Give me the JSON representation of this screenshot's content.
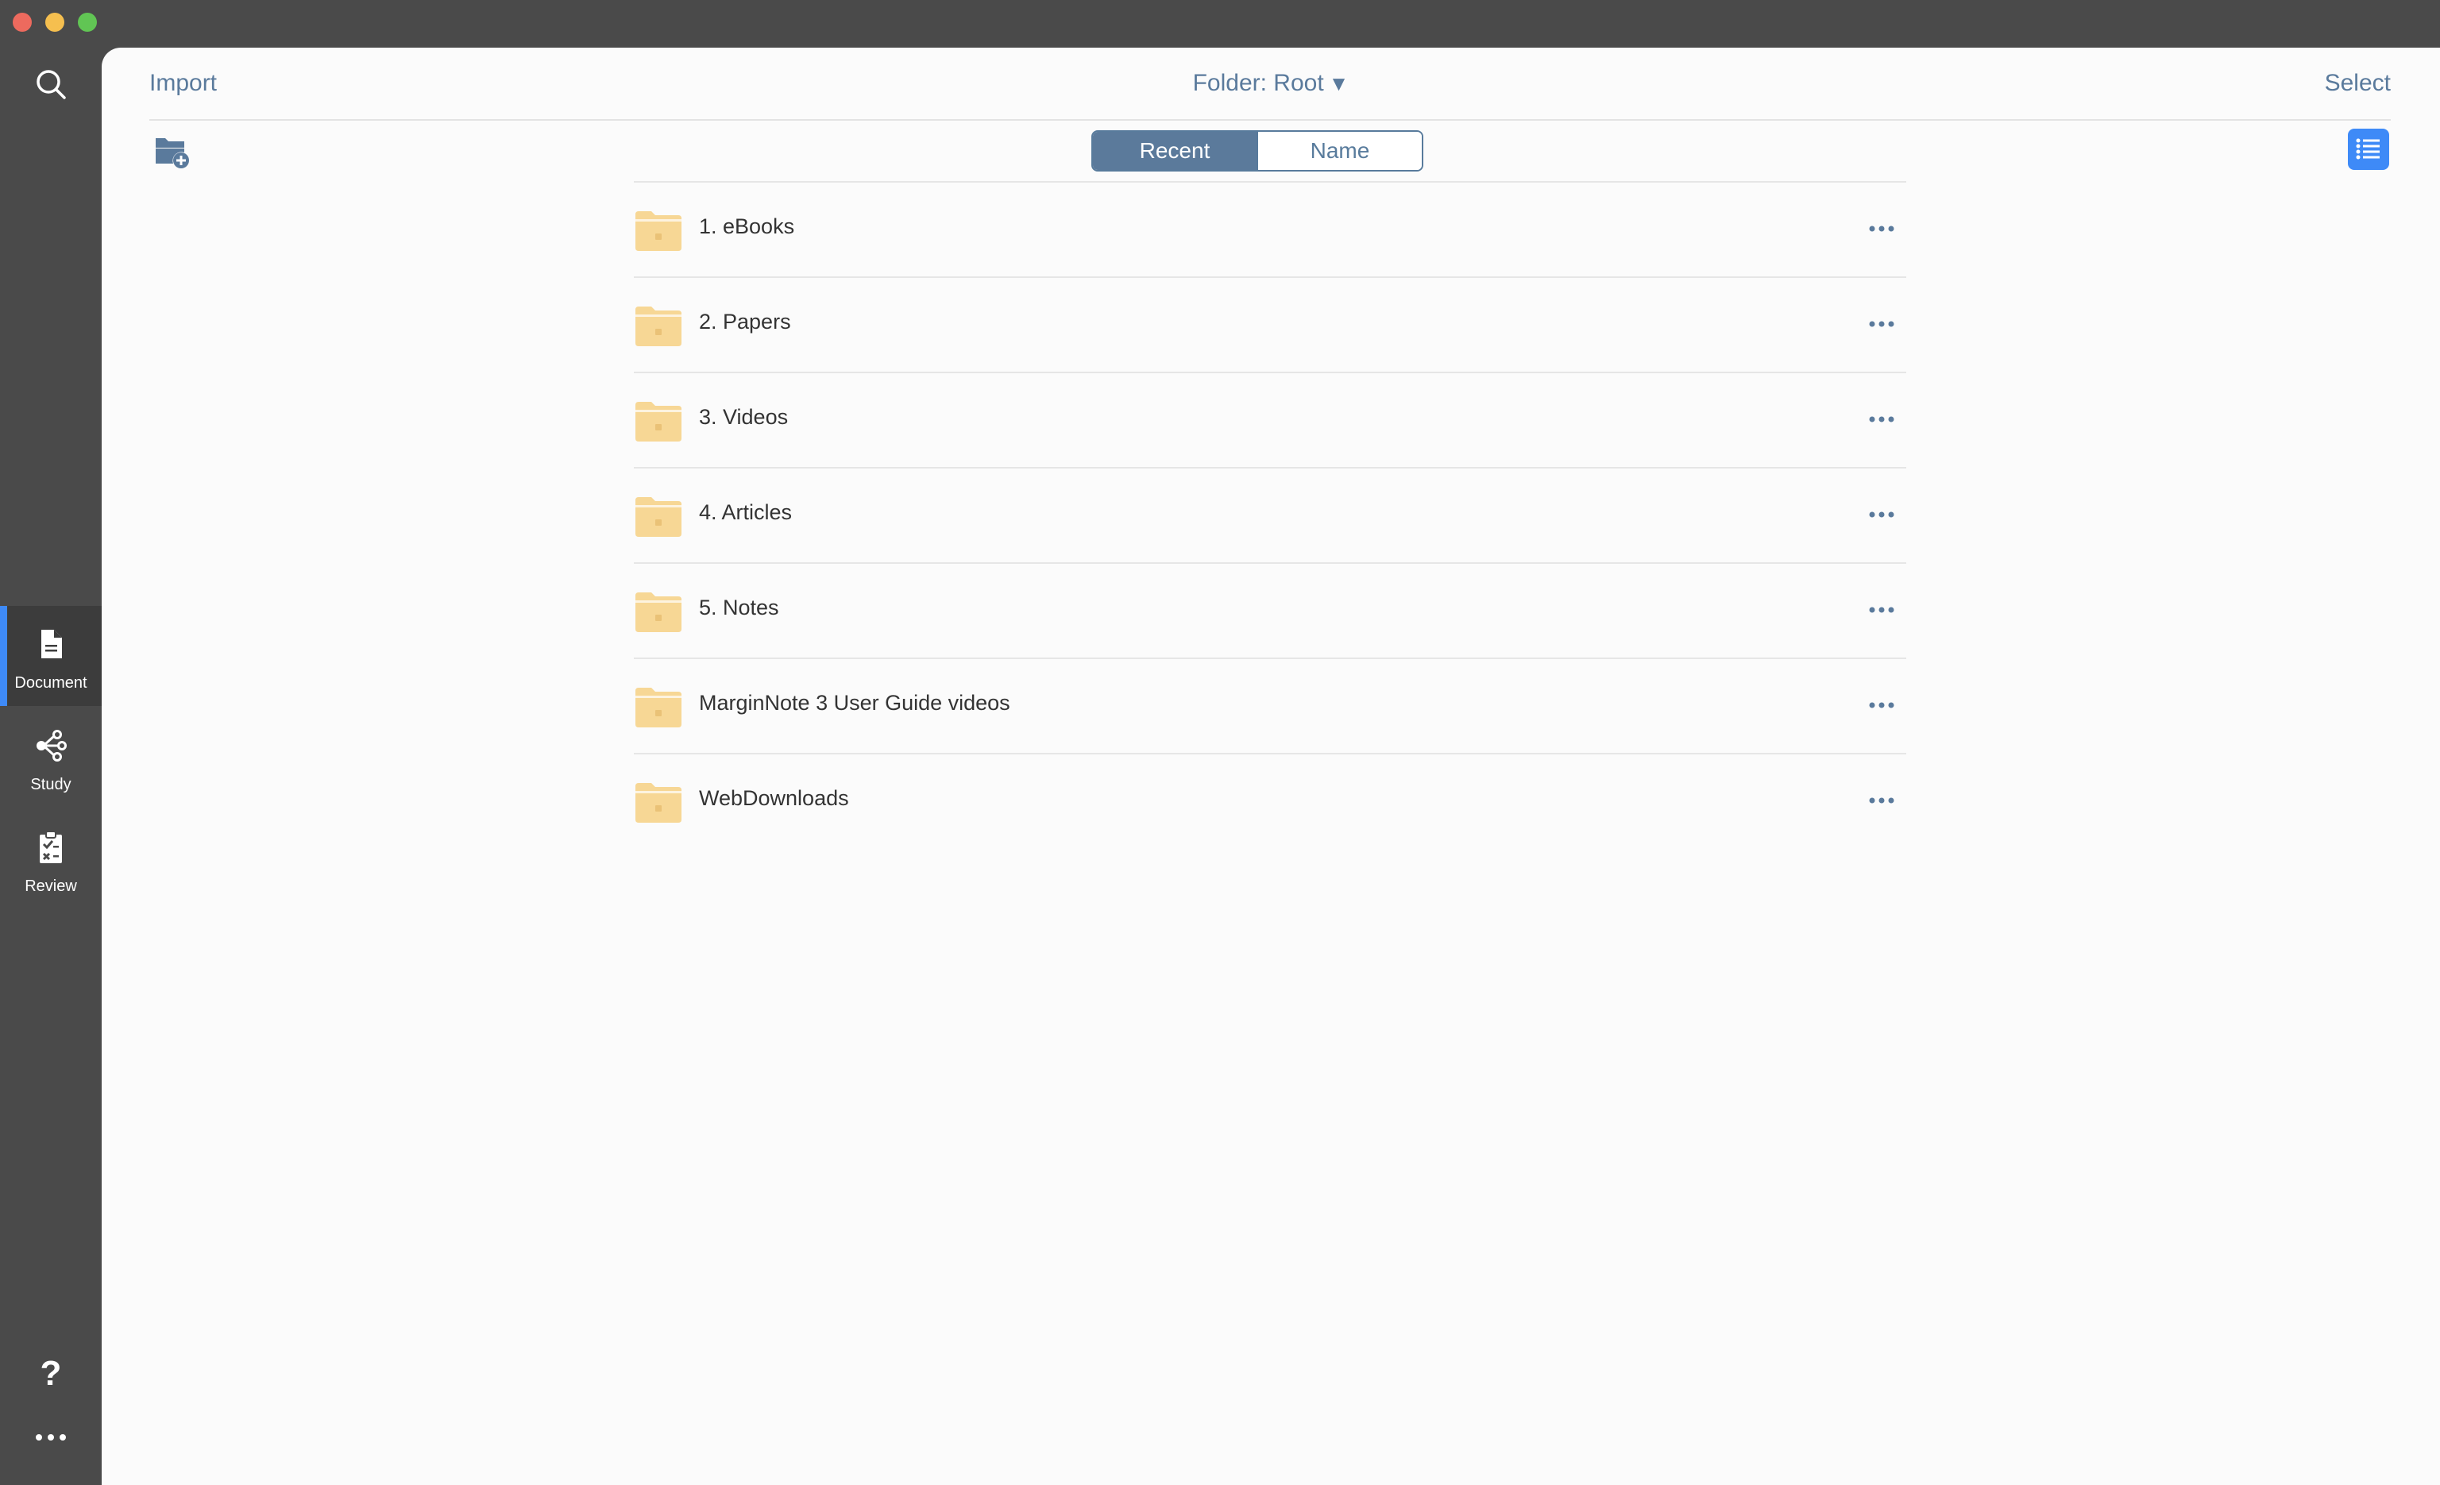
{
  "window": {
    "controls": [
      "close",
      "minimize",
      "maximize"
    ]
  },
  "sidebar": {
    "search_icon": "search-icon",
    "items": [
      {
        "label": "Document",
        "icon": "document-icon",
        "active": true
      },
      {
        "label": "Study",
        "icon": "mindmap-icon",
        "active": false
      },
      {
        "label": "Review",
        "icon": "clipboard-check-icon",
        "active": false
      }
    ],
    "help_icon": "?",
    "more_icon": "more-icon"
  },
  "header": {
    "import_label": "Import",
    "folder_label": "Folder: Root",
    "folder_caret": "▼",
    "select_label": "Select"
  },
  "sort": {
    "options": [
      "Recent",
      "Name"
    ],
    "selected": "Recent"
  },
  "folders": [
    {
      "name": "1. eBooks"
    },
    {
      "name": "2. Papers"
    },
    {
      "name": "3. Videos"
    },
    {
      "name": "4. Articles"
    },
    {
      "name": "5. Notes"
    },
    {
      "name": "MarginNote 3 User Guide videos"
    },
    {
      "name": "WebDownloads"
    }
  ],
  "colors": {
    "accent": "#3e8af7",
    "link": "#5a7a9c",
    "folder": "#f7d795",
    "sidebar": "#4a4a4a"
  }
}
